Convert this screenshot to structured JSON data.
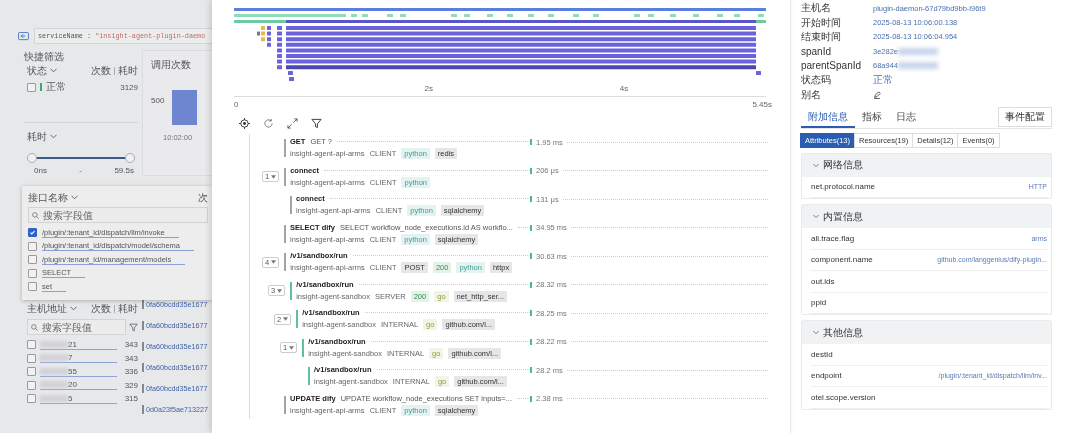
{
  "background": {
    "query": {
      "key": "serviceName",
      "op": ":",
      "value": "\"insight-agent-plugin-daemo"
    },
    "quick_filter": {
      "title": "快捷筛选"
    },
    "status_filter": {
      "title": "状态",
      "col_count": "次数",
      "col_time": "耗时",
      "items": [
        {
          "label": "正常",
          "count": "3129",
          "checked": false,
          "color": "#3fa67a"
        }
      ]
    },
    "duration_filter": {
      "title": "耗时",
      "level": 1,
      "min": "0ns",
      "sep": "-",
      "max": "59.5s"
    },
    "call_chart": {
      "title": "调用次数",
      "y_tick": "500",
      "x_tick": "10:02:00"
    },
    "endpoint_filter": {
      "title": "接口名称",
      "col_count": "次",
      "placeholder": "搜索字段值",
      "items": [
        {
          "label": "/plugin/:tenant_id/dispatch/llm/invoke",
          "checked": true
        },
        {
          "label": "/plugin/:tenant_id/dispatch/model/schema",
          "checked": false
        },
        {
          "label": "/plugin/:tenant_id/management/models",
          "checked": false
        },
        {
          "label": "SELECT",
          "checked": false
        },
        {
          "label": "set",
          "checked": false
        }
      ]
    },
    "host_filter": {
      "title": "主机地址",
      "col_count": "次数",
      "col_time": "耗时",
      "placeholder": "搜索字段值",
      "items": [
        {
          "label": "21",
          "count": "343",
          "checked": false
        },
        {
          "label": "7",
          "count": "343",
          "checked": false
        },
        {
          "label": "55",
          "count": "336",
          "checked": false
        },
        {
          "label": "20",
          "count": "329",
          "checked": false
        },
        {
          "label": "5",
          "count": "315",
          "checked": false
        }
      ]
    },
    "trace_ids": [
      "0fa60bcdd35e1677",
      "0fa60bcdd35e1677",
      "0fa60bcdd35e1677",
      "0fa60bcdd35e1677",
      "0fa60bcdd35e1677",
      "0d0a23f5ae713227"
    ]
  },
  "waterfall": {
    "axis_inner": [
      "2s",
      "4s"
    ],
    "axis_start": "0",
    "axis_end": "5.45s"
  },
  "spans": [
    {
      "name": "GET",
      "detail": "GET ?",
      "service": "insight-agent-api-arms",
      "span_kind": "CLIENT",
      "color": "#a3a3a3",
      "tags": [
        {
          "text": "python",
          "kind": "python"
        },
        {
          "text": "redis",
          "kind": "library"
        }
      ],
      "duration": "1.95 ms"
    },
    {
      "name": "connect",
      "service": "insight-agent-api-arms",
      "span_kind": "CLIENT",
      "color": "#a3a3a3",
      "tags": [
        {
          "text": "python",
          "kind": "python"
        }
      ],
      "duration": "206 μs",
      "count": "1",
      "expanded": true,
      "children": [
        {
          "name": "connect",
          "service": "insight-agent-api-arms",
          "span_kind": "CLIENT",
          "color": "#a3a3a3",
          "tags": [
            {
              "text": "python",
              "kind": "python"
            },
            {
              "text": "sqlalchemy",
              "kind": "library"
            }
          ],
          "duration": "131 μs"
        }
      ]
    },
    {
      "name": "SELECT dify",
      "detail": "SELECT workflow_node_executions.id AS workflo...",
      "service": "insight-agent-api-arms",
      "span_kind": "CLIENT",
      "color": "#a3a3a3",
      "tags": [
        {
          "text": "python",
          "kind": "python"
        },
        {
          "text": "sqlalchemy",
          "kind": "library"
        }
      ],
      "duration": "34.95 ms"
    },
    {
      "name": "/v1/sandbox/run",
      "service": "insight-agent-api-arms",
      "span_kind": "CLIENT",
      "color": "#a3a3a3",
      "tags": [
        {
          "text": "POST",
          "kind": "library"
        },
        {
          "text": "200",
          "kind": "status"
        },
        {
          "text": "python",
          "kind": "python"
        },
        {
          "text": "httpx",
          "kind": "library"
        }
      ],
      "duration": "30.63 ms",
      "count": "4",
      "expanded": true,
      "children": [
        {
          "name": "/v1/sandbox/run",
          "service": "insight-agent-sandbox",
          "span_kind": "SERVER",
          "color": "#5fc397",
          "tags": [
            {
              "text": "200",
              "kind": "status"
            },
            {
              "text": "go",
              "kind": "go"
            },
            {
              "text": "net_http_ser...",
              "kind": "library"
            }
          ],
          "duration": "28.32 ms",
          "count": "3",
          "expanded": true,
          "children": [
            {
              "name": "/v1/sandbox/run",
              "service": "insight-agent-sandbox",
              "span_kind": "INTERNAL",
              "color": "#5fc397",
              "tags": [
                {
                  "text": "go",
                  "kind": "go"
                },
                {
                  "text": "github.com/l...",
                  "kind": "library"
                }
              ],
              "duration": "28.25 ms",
              "count": "2",
              "expanded": true,
              "children": [
                {
                  "name": "/v1/sandbox/run",
                  "service": "insight-agent-sandbox",
                  "span_kind": "INTERNAL",
                  "color": "#5fc397",
                  "tags": [
                    {
                      "text": "go",
                      "kind": "go"
                    },
                    {
                      "text": "github.com/l...",
                      "kind": "library"
                    }
                  ],
                  "duration": "28.22 ms",
                  "count": "1",
                  "expanded": true,
                  "children": [
                    {
                      "name": "/v1/sandbox/run",
                      "service": "insight-agent-sandbox",
                      "span_kind": "INTERNAL",
                      "color": "#5fc397",
                      "tags": [
                        {
                          "text": "go",
                          "kind": "go"
                        },
                        {
                          "text": "github.com/l...",
                          "kind": "library"
                        }
                      ],
                      "duration": "28.2 ms"
                    }
                  ]
                }
              ]
            }
          ]
        }
      ]
    },
    {
      "name": "UPDATE dify",
      "detail": "UPDATE workflow_node_executions SET inputs=...",
      "service": "insight-agent-api-arms",
      "span_kind": "CLIENT",
      "color": "#a3a3a3",
      "tags": [
        {
          "text": "python",
          "kind": "python"
        },
        {
          "text": "sqlalchemy",
          "kind": "library"
        }
      ],
      "duration": "2.38 ms"
    }
  ],
  "details": {
    "fields": [
      {
        "label": "主机名",
        "value": "plugin-daemon-67d79bd9bb-l96t9",
        "kind": "text"
      },
      {
        "label": "开始时间",
        "value": "2025-08-13 10:06:00.138",
        "kind": "text"
      },
      {
        "label": "结束时间",
        "value": "2025-08-13 10:06:04.954",
        "kind": "text"
      },
      {
        "label": "spanId",
        "value": "3e282e",
        "kind": "blurred"
      },
      {
        "label": "parentSpanId",
        "value": "68a944",
        "kind": "blurred"
      },
      {
        "label": "状态码",
        "value": "正常",
        "kind": "text"
      },
      {
        "label": "别名",
        "kind": "edit"
      }
    ],
    "tabs": [
      {
        "label": "附加信息",
        "selected": true
      },
      {
        "label": "指标",
        "selected": false
      },
      {
        "label": "日志",
        "selected": false
      }
    ],
    "config_button": "事件配置",
    "subtabs": [
      {
        "label": "Attributes(13)",
        "selected": true
      },
      {
        "label": "Resources(19)",
        "selected": false
      },
      {
        "label": "Details(12)",
        "selected": false
      },
      {
        "label": "Events(0)",
        "selected": false
      }
    ],
    "sections": [
      {
        "title": "网络信息",
        "expanded": true,
        "rows": [
          {
            "key": "net.protocol.name",
            "value": "HTTP"
          }
        ]
      },
      {
        "title": "内置信息",
        "expanded": true,
        "rows": [
          {
            "key": "ali.trace.flag",
            "value": "arms"
          },
          {
            "key": "component.name",
            "value": "github.com/langgenius/dify-plugin..."
          },
          {
            "key": "out.ids"
          },
          {
            "key": "ppid"
          }
        ]
      },
      {
        "title": "其他信息",
        "expanded": true,
        "rows": [
          {
            "key": "destId"
          },
          {
            "key": "endpoint",
            "value": "/plugin/:tenant_id/dispatch/llm/inv..."
          },
          {
            "key": "otel.scope.version"
          }
        ]
      }
    ]
  }
}
